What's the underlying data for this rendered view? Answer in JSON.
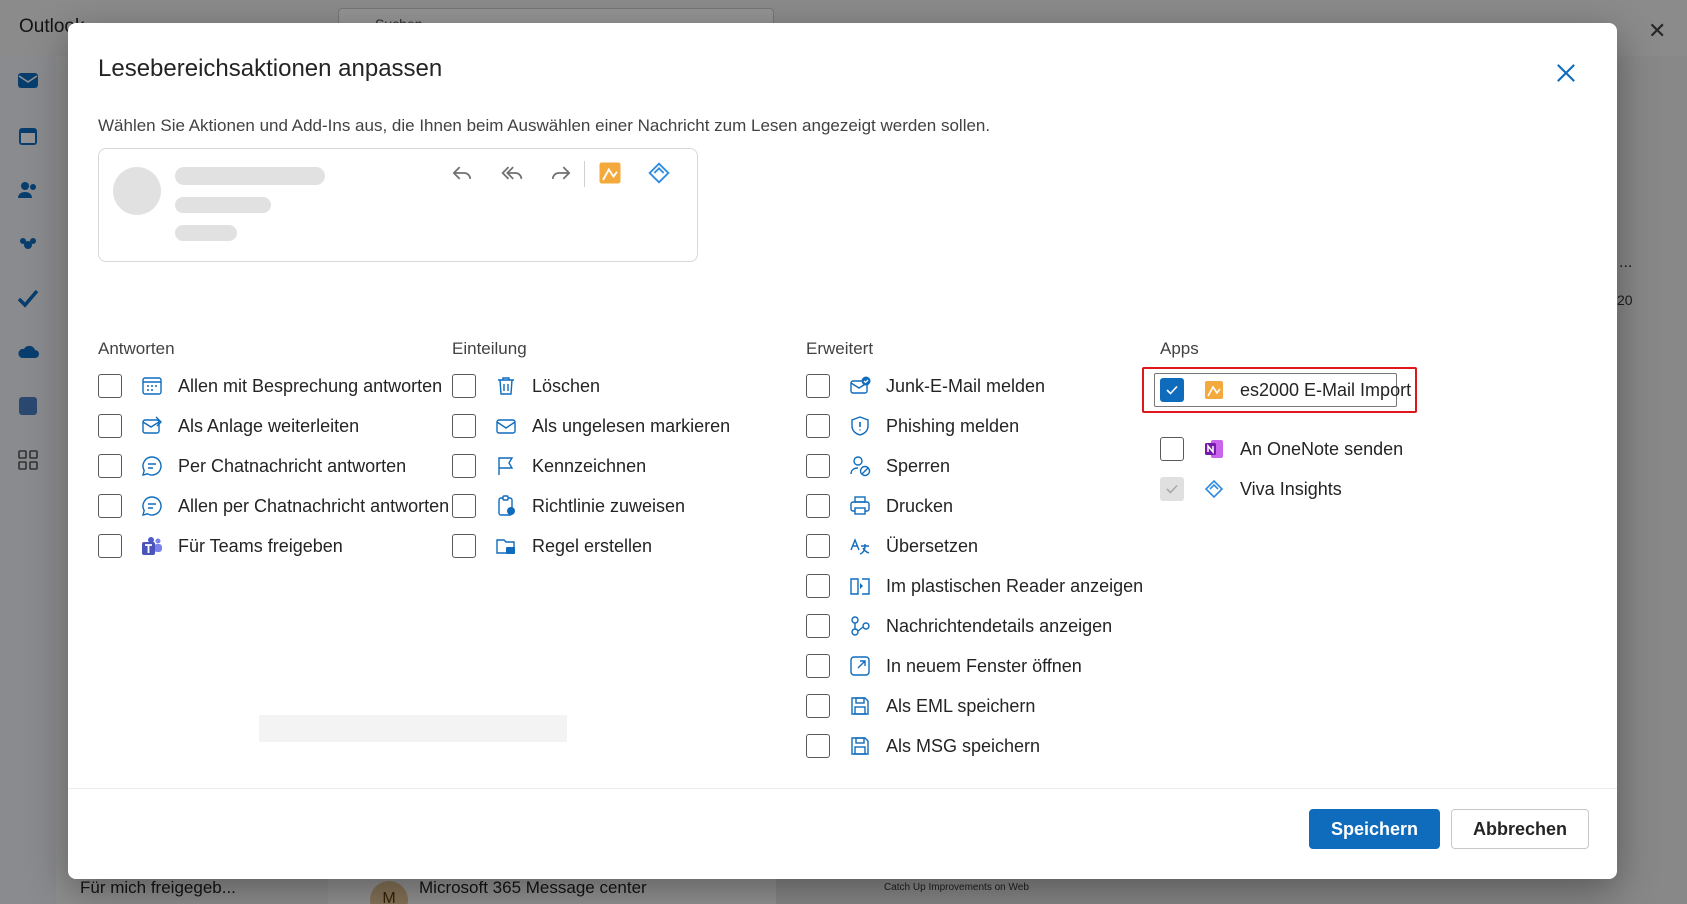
{
  "background": {
    "brand": "Outlook",
    "search_placeholder": "Suchen",
    "folder_item": "Für mich freigegeb...",
    "message_sender": "Microsoft 365 Message center",
    "message_avatar": "M",
    "reading_snippet": "Catch Up Improvements on Web",
    "time_fragment": "20",
    "more": "..."
  },
  "dialog": {
    "title": "Lesebereichsaktionen anpassen",
    "description": "Wählen Sie Aktionen und Add-Ins aus, die Ihnen beim Auswählen einer Nachricht zum Lesen angezeigt werden sollen.",
    "close_icon": "close-icon"
  },
  "preview": {
    "tools": [
      "reply-icon",
      "reply-all-icon",
      "forward-icon",
      "es2000-app-icon",
      "viva-insights-icon"
    ]
  },
  "sections": {
    "antworten": {
      "title": "Antworten",
      "items": [
        {
          "label": "Allen mit Besprechung antworten",
          "icon": "calendar-reply-icon",
          "checked": false
        },
        {
          "label": "Als Anlage weiterleiten",
          "icon": "mail-attach-icon",
          "checked": false
        },
        {
          "label": "Per Chatnachricht antworten",
          "icon": "chat-icon",
          "checked": false
        },
        {
          "label": "Allen per Chatnachricht antworten",
          "icon": "chat-all-icon",
          "checked": false
        },
        {
          "label": "Für Teams freigeben",
          "icon": "teams-icon",
          "checked": false
        }
      ]
    },
    "einteilung": {
      "title": "Einteilung",
      "items": [
        {
          "label": "Löschen",
          "icon": "trash-icon",
          "checked": false
        },
        {
          "label": "Als ungelesen markieren",
          "icon": "mail-unread-icon",
          "checked": false
        },
        {
          "label": "Kennzeichnen",
          "icon": "flag-icon",
          "checked": false
        },
        {
          "label": "Richtlinie zuweisen",
          "icon": "policy-icon",
          "checked": false
        },
        {
          "label": "Regel erstellen",
          "icon": "rule-icon",
          "checked": false
        }
      ]
    },
    "erweitert": {
      "title": "Erweitert",
      "items": [
        {
          "label": "Junk-E-Mail melden",
          "icon": "junk-icon",
          "checked": false
        },
        {
          "label": "Phishing melden",
          "icon": "shield-icon",
          "checked": false
        },
        {
          "label": "Sperren",
          "icon": "block-user-icon",
          "checked": false
        },
        {
          "label": "Drucken",
          "icon": "print-icon",
          "checked": false
        },
        {
          "label": "Übersetzen",
          "icon": "translate-icon",
          "checked": false
        },
        {
          "label": "Im plastischen Reader anzeigen",
          "icon": "immersive-reader-icon",
          "checked": false
        },
        {
          "label": "Nachrichtendetails anzeigen",
          "icon": "details-icon",
          "checked": false
        },
        {
          "label": "In neuem Fenster öffnen",
          "icon": "open-window-icon",
          "checked": false
        },
        {
          "label": "Als EML speichern",
          "icon": "save-icon",
          "checked": false
        },
        {
          "label": "Als MSG speichern",
          "icon": "save-icon",
          "checked": false
        }
      ]
    },
    "apps": {
      "title": "Apps",
      "items": [
        {
          "label": "es2000 E-Mail Import",
          "icon": "es2000-app-icon",
          "checked": true
        },
        {
          "label": "An OneNote senden",
          "icon": "onenote-icon",
          "checked": false
        },
        {
          "label": "Viva Insights",
          "icon": "viva-insights-icon",
          "checked": true,
          "disabled": true
        }
      ]
    }
  },
  "footer": {
    "save_label": "Speichern",
    "cancel_label": "Abbrechen"
  },
  "colors": {
    "accent": "#0f6cbd",
    "highlight": "#e0161f"
  }
}
